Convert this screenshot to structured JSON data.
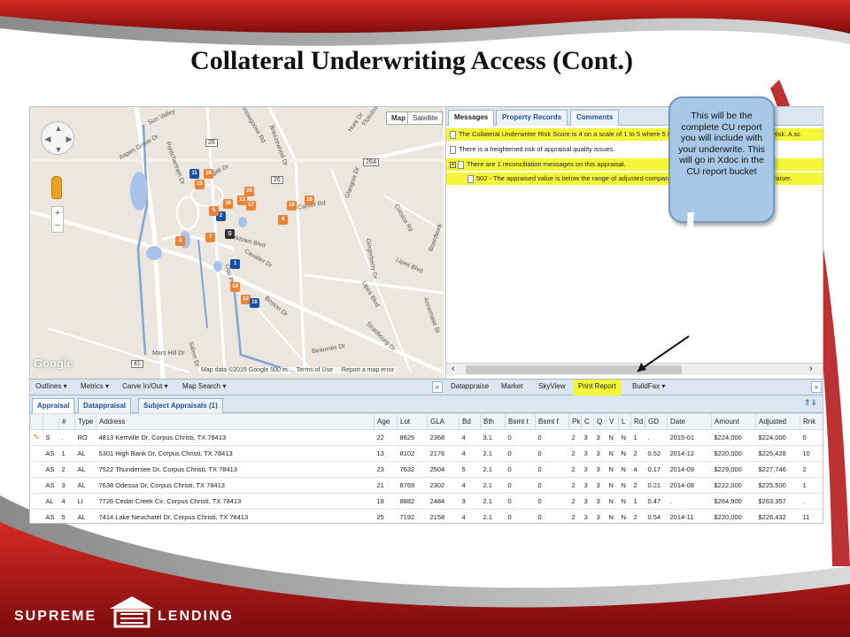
{
  "slide": {
    "title": "Collateral Underwriting Access (Cont.)"
  },
  "map": {
    "type_buttons": [
      "Map",
      "Satellite"
    ],
    "selected_type": "Map",
    "street_labels": [
      "Sun Valley",
      "Aspen Grove Dr",
      "Snowgoose Rd",
      "Breezewood Dr",
      "Hunt Dr",
      "Flossburg Rd",
      "Pontchartrain Dr",
      "Mcgali Dr",
      "Glasgow Dr",
      "Carver Rd",
      "Corsica Rd",
      "Boardwalk",
      "Lipes Blvd",
      "Lipes Blvd",
      "Oso Pkwy",
      "Boston Dr",
      "Gingerberry Dr",
      "Annemase St",
      "Beauvais Dr",
      "Strasbourg Dr",
      "Mars Hill Dr",
      "Salem Dr",
      "Yorktown Blvd",
      "Cavalier Dr"
    ],
    "route_labels": [
      "26",
      "26",
      "26A",
      "41"
    ],
    "pins": [
      "18",
      "11",
      "16",
      "15",
      "20",
      "13",
      "17",
      "18",
      "16",
      "2",
      "5",
      "4",
      "7",
      "3",
      "S",
      "1",
      "14",
      "12",
      "10"
    ],
    "google_label": "Google",
    "footer": "Map data ©2015 Google   500 m",
    "footer_terms": "Terms of Use",
    "footer_report": "Report a map error"
  },
  "panel": {
    "tabs": [
      "Messages",
      "Property Records",
      "Comments"
    ],
    "active_tab": "Messages",
    "messages": [
      {
        "text": "The Collateral Underwriter Risk Score is 4 on a scale of 1 to 5 where 5 indicates highest potential collateral risk. A sc",
        "highlight": true,
        "indent": false,
        "expand": false
      },
      {
        "text": "There is a heightened risk of appraisal quality issues.",
        "highlight": false,
        "indent": false,
        "expand": false
      },
      {
        "text": "There are 1 reconciliation messages on this appraisal.",
        "highlight": true,
        "indent": false,
        "expand": true
      },
      {
        "text": "502 - The appraised value is below the range of adjusted comparable sale prices provided by the appraiser.",
        "highlight": true,
        "indent": true,
        "expand": false
      }
    ]
  },
  "callout": {
    "text": "This will be the complete CU report you will include with your underwrite. This will go in Xdoc in the CU report bucket"
  },
  "left_toolbar": [
    "Outlines ▾",
    "Metrics ▾",
    "Carve In/Out ▾",
    "Map Search ▾"
  ],
  "left_toggle": "«",
  "right_toolbar": [
    "Datappraise",
    "Market",
    "SkyView",
    "Print Report",
    "BuildFax ▾"
  ],
  "right_toggle": "»",
  "grid_tabs": [
    "Appraisal",
    "Datappraisal",
    "Subject Appraisals (1)"
  ],
  "grid_controls": "⇑⇓",
  "table": {
    "columns": [
      "",
      "",
      "#",
      "Type",
      "Address",
      "Age",
      "Lot",
      "GLA",
      "Bd",
      "Bth",
      "Bsmt t",
      "Bsmt f",
      "Pk",
      "C",
      "Q",
      "V",
      "L",
      "Rd",
      "GD",
      "Date",
      "Amount",
      "Adjusted",
      "Rnk"
    ],
    "rows": [
      [
        "✎",
        "S",
        ".",
        "RO",
        "4813 Kerrville Dr, Corpus Christi, TX 78413",
        "22",
        "8625",
        "2368",
        "4",
        "3.1",
        "0",
        "0",
        "2",
        "3",
        "3",
        "N",
        "N",
        "1",
        ".",
        "2015-01",
        "$224,000",
        "$224,000",
        "0"
      ],
      [
        "",
        "AS",
        "1",
        "AL",
        "5301 High Bank Dr, Corpus Christi, TX 78413",
        "13",
        "8102",
        "2176",
        "4",
        "2.1",
        "0",
        "0",
        "2",
        "3",
        "3",
        "N",
        "N",
        "2",
        "0.52",
        "2014-12",
        "$220,000",
        "$225,428",
        "10"
      ],
      [
        "",
        "AS",
        "2",
        "AL",
        "7522 Thundersee Dr, Corpus Christi, TX 78413",
        "23",
        "7632",
        "2504",
        "5",
        "2.1",
        "0",
        "0",
        "2",
        "3",
        "3",
        "N",
        "N",
        "4",
        "0.17",
        "2014-09",
        "$229,000",
        "$227,746",
        "2"
      ],
      [
        "",
        "AS",
        "3",
        "AL",
        "7638 Odessa Dr, Corpus Christi, TX 78413",
        "21",
        "8769",
        "2302",
        "4",
        "2.1",
        "0",
        "0",
        "2",
        "3",
        "3",
        "N",
        "N",
        "2",
        "0.21",
        "2014-08",
        "$222,000",
        "$225,500",
        "1"
      ],
      [
        "",
        "AL",
        "4",
        "LI",
        "7726 Cedar Creek Cir, Corpus Christi, TX 78413",
        "18",
        "8882",
        "2484",
        "3",
        "2.1",
        "0",
        "0",
        "2",
        "3",
        "3",
        "N",
        "N",
        "1",
        "0.47",
        ".",
        "$264,900",
        "$263,357",
        "."
      ],
      [
        "",
        "AS",
        "5",
        "AL",
        "7414 Lake Neuchatel Dr, Corpus Christi, TX 78413",
        "25",
        "7192",
        "2158",
        "4",
        "2.1",
        "0",
        "0",
        "2",
        "3",
        "3",
        "N",
        "N",
        "2",
        "0.54",
        "2014-11",
        "$220,000",
        "$226,432",
        "11"
      ]
    ]
  },
  "logo": {
    "word1": "SUPREME",
    "word2": "LENDING"
  },
  "colors": {
    "highlight": "#f5f53a",
    "header_bg": "#dce6f1",
    "link": "#1c4f9c",
    "brand_red": "#c0151a"
  }
}
